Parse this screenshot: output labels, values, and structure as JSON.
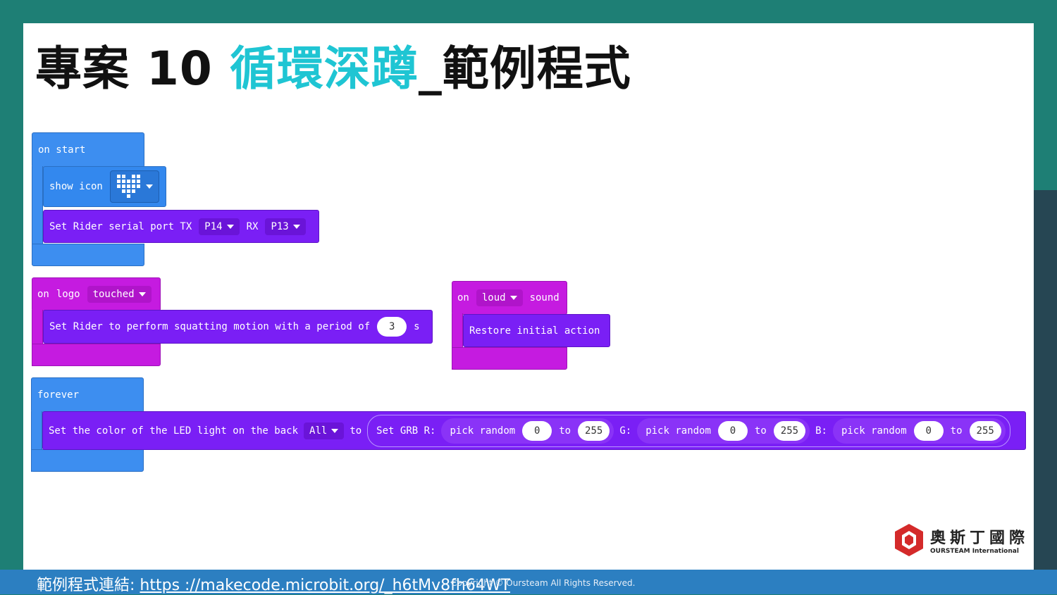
{
  "title": {
    "main": "專案 10 ",
    "accent": "循環深蹲",
    "tail": "_範例程式"
  },
  "on_start": {
    "hat_label": "on start",
    "show_icon_label": "show icon",
    "serial_label": "Set Rider serial port TX",
    "tx_value": "P14",
    "rx_label": "RX",
    "rx_value": "P13"
  },
  "on_logo": {
    "on_label": "on",
    "logo_label": "logo",
    "event_value": "touched",
    "action_label": "Set Rider to perform squatting motion with a period of",
    "period_value": "3",
    "unit_label": "s"
  },
  "on_loud": {
    "on_label": "on",
    "loud_value": "loud",
    "sound_label": "sound",
    "action_label": "Restore initial action"
  },
  "forever": {
    "hat_label": "forever",
    "led_label": "Set the color of the LED light on the back",
    "led_target": "All",
    "to_label": "to",
    "grb_label": "Set GRB R:",
    "g_label": "G:",
    "b_label": "B:",
    "pick_label": "pick random",
    "to2_label": "to",
    "r_min": "0",
    "r_max": "255",
    "g_min": "0",
    "g_max": "255",
    "b_min": "0",
    "b_max": "255"
  },
  "footer": {
    "link_label": "範例程式連結:",
    "link_url": "https ://makecode.microbit.org/_h6tMv8fh64WT",
    "copyright": "Copyright © Oursteam All Rights Reserved."
  },
  "logo": {
    "cn": "奧斯丁國際",
    "en": "OURSTEAM International"
  },
  "colors": {
    "accent": "#1fc5d3",
    "blue": "#3d8ef0",
    "purple": "#7a1ff5",
    "magenta": "#c51be0",
    "footer": "#2c7fc1"
  }
}
